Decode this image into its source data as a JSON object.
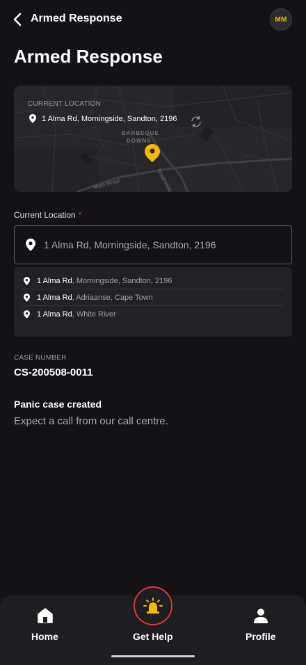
{
  "header": {
    "title": "Armed Response",
    "avatar_initials": "MM"
  },
  "page": {
    "title": "Armed Response"
  },
  "map": {
    "caption": "CURRENT LOCATION",
    "address": "1 Alma Rd, Morningside, Sandton, 2196",
    "area_label_1": "BARBEQUE",
    "area_label_2": "DOWNS",
    "road_label_1": "Main Road",
    "road_label_2": "Wodmead Drive"
  },
  "location_field": {
    "label": "Current Location",
    "required_mark": "*",
    "value": "1 Alma Rd, Morningside, Sandton, 2196"
  },
  "suggestions": [
    {
      "main": "1 Alma Rd",
      "rest": ", Morningside, Sandton, 2196"
    },
    {
      "main": "1 Alma Rd",
      "rest": ", Adriaanse, Cape Town"
    },
    {
      "main": "1 Alma Rd",
      "rest": ", White River"
    }
  ],
  "case": {
    "caption": "CASE NUMBER",
    "number": "CS-200508-0011"
  },
  "status": {
    "title": "Panic case created",
    "message": "Expect a call from our call centre."
  },
  "nav": {
    "home": "Home",
    "help": "Get Help",
    "profile": "Profile"
  },
  "colors": {
    "background": "#131217",
    "accent_yellow": "#f5b700",
    "danger_red": "#e0352b"
  },
  "icons": [
    "back-icon",
    "pin-icon",
    "refresh-icon",
    "home-icon",
    "siren-icon",
    "person-icon"
  ]
}
